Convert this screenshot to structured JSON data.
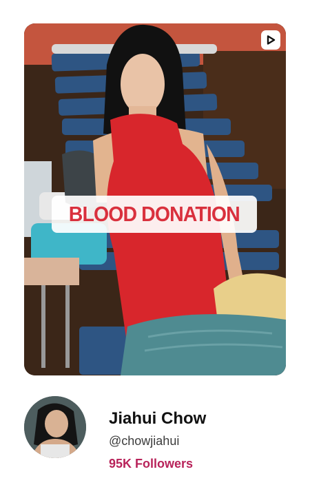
{
  "post": {
    "caption": "BLOOD DONATION",
    "media_type_icon": "play-video-icon"
  },
  "profile": {
    "name": "Jiahui Chow",
    "handle": "@chowjiahui",
    "followers": "95K Followers",
    "avatar_icon": "profile-avatar"
  },
  "colors": {
    "caption_text": "#d9303d",
    "followers_text": "#b8235a",
    "dress": "#d8262c",
    "chair": "#2d4f77"
  }
}
